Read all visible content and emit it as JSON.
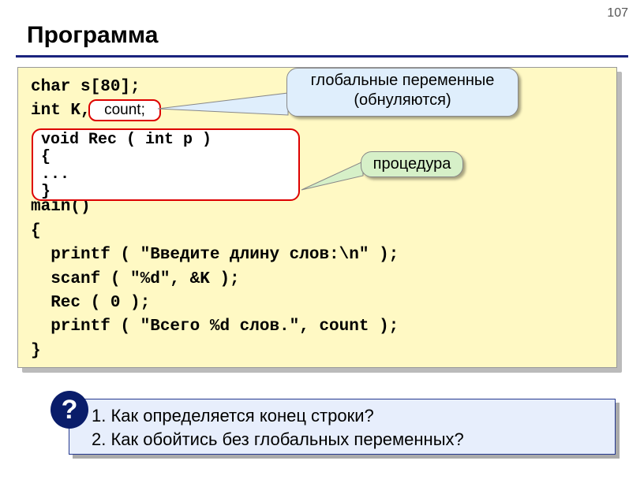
{
  "page_number": "107",
  "title": "Программа",
  "code": {
    "line1": "char s[80];",
    "line2_prefix": "int K,",
    "count_label": "count;",
    "rec_block": "void Rec ( int p )\n{\n...\n}",
    "after_rec": "main()\n{\n  printf ( \"Введите длину слов:\\n\" );\n  scanf ( \"%d\", &K );\n  Rec ( 0 );\n  printf ( \"Всего %d слов.\", count );\n}"
  },
  "callouts": {
    "globals": "глобальные переменные\n(обнуляются)",
    "procedure": "процедура"
  },
  "questions": {
    "mark": "?",
    "q1": "1. Как определяется конец строки?",
    "q2": "2. Как обойтись без глобальных переменных?"
  }
}
